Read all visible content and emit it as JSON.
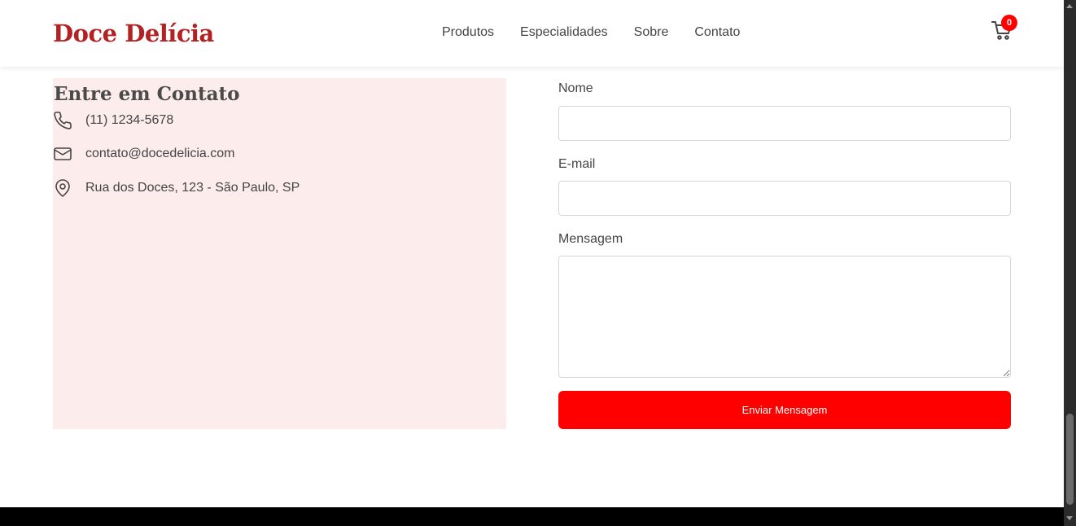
{
  "header": {
    "logo": "Doce Delícia",
    "nav": [
      "Produtos",
      "Especialidades",
      "Sobre",
      "Contato"
    ],
    "cart_count": "0",
    "cart_icon": "cart-icon"
  },
  "contact_info": {
    "title": "Entre em Contato",
    "phone": "(11) 1234-5678",
    "email": "contato@docedelicia.com",
    "address": "Rua dos Doces, 123 - São Paulo, SP",
    "icons": [
      "phone-icon",
      "mail-icon",
      "map-pin-icon"
    ]
  },
  "form": {
    "name_label": "Nome",
    "name_value": "",
    "email_label": "E-mail",
    "email_value": "",
    "message_label": "Mensagem",
    "message_value": "",
    "submit_label": "Enviar Mensagem"
  },
  "colors": {
    "brand": "#b32222",
    "accent": "#ff0000",
    "panel_bg": "#fdecec"
  }
}
